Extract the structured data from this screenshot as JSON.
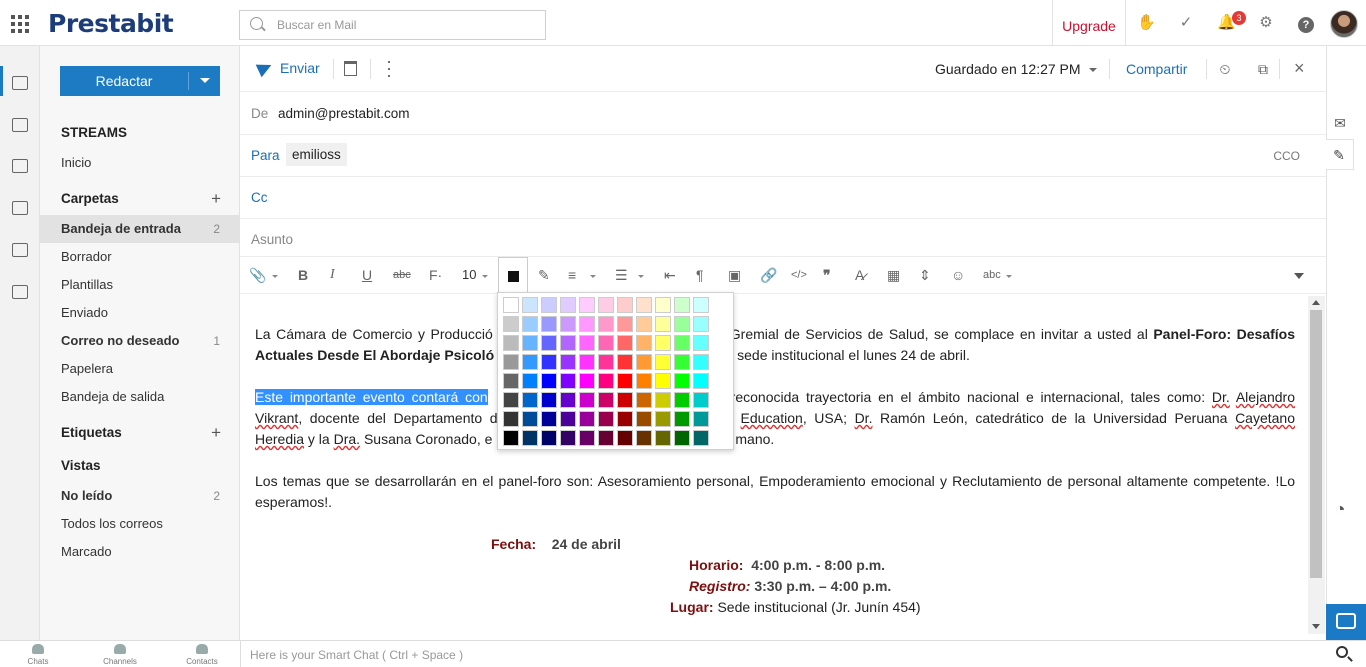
{
  "app": {
    "logo": "Prestabit"
  },
  "search": {
    "placeholder": "Buscar en Mail"
  },
  "topbar": {
    "upgrade": "Upgrade",
    "notification_count": "3",
    "help": "?"
  },
  "sidebar": {
    "compose": "Redactar",
    "streams_header": "STREAMS",
    "inicio": "Inicio",
    "folders_header": "Carpetas",
    "folders": [
      {
        "label": "Bandeja de entrada",
        "count": "2"
      },
      {
        "label": "Borrador",
        "count": ""
      },
      {
        "label": "Plantillas",
        "count": ""
      },
      {
        "label": "Enviado",
        "count": ""
      },
      {
        "label": "Correo no deseado",
        "count": "1"
      },
      {
        "label": "Papelera",
        "count": ""
      },
      {
        "label": "Bandeja de salida",
        "count": ""
      }
    ],
    "tags_header": "Etiquetas",
    "views_header": "Vistas",
    "views": [
      {
        "label": "No leído",
        "count": "2"
      },
      {
        "label": "Todos los correos",
        "count": ""
      },
      {
        "label": "Marcado",
        "count": ""
      }
    ]
  },
  "toolbar": {
    "send": "Enviar",
    "saved": "Guardado en 12:27 PM",
    "share": "Compartir"
  },
  "compose": {
    "from_label": "De",
    "from_value": "admin@prestabit.com",
    "to_label": "Para",
    "to_chip": "emilioss",
    "cco": "CCO",
    "cc_label": "Cc",
    "subject_placeholder": "Asunto"
  },
  "format": {
    "font_size": "10",
    "current_color": "#111111"
  },
  "palette": {
    "rows": [
      [
        "#ffffff",
        "#cce5ff",
        "#ccccff",
        "#e0ccff",
        "#ffccff",
        "#ffcce6",
        "#ffcccc",
        "#ffe0cc",
        "#ffffcc",
        "#ccffcc",
        "#ccffff"
      ],
      [
        "#cccccc",
        "#99ccff",
        "#9999ff",
        "#cc99ff",
        "#ff99ff",
        "#ff99cc",
        "#ff9999",
        "#ffcc99",
        "#ffff99",
        "#99ff99",
        "#99ffff"
      ],
      [
        "#bbbbbb",
        "#66b3ff",
        "#6666ff",
        "#b366ff",
        "#ff66ff",
        "#ff66b3",
        "#ff6666",
        "#ffb366",
        "#ffff66",
        "#66ff66",
        "#66ffff"
      ],
      [
        "#999999",
        "#3399ff",
        "#3333ff",
        "#9933ff",
        "#ff33ff",
        "#ff3399",
        "#ff3333",
        "#ff9933",
        "#ffff33",
        "#33ff33",
        "#33ffff"
      ],
      [
        "#666666",
        "#0080ff",
        "#0000ff",
        "#8000ff",
        "#ff00ff",
        "#ff0080",
        "#ff0000",
        "#ff8000",
        "#ffff00",
        "#00ff00",
        "#00ffff"
      ],
      [
        "#444444",
        "#0066cc",
        "#0000cc",
        "#6600cc",
        "#cc00cc",
        "#cc0066",
        "#cc0000",
        "#cc6600",
        "#cccc00",
        "#00cc00",
        "#00cccc"
      ],
      [
        "#333333",
        "#004c99",
        "#000099",
        "#4c0099",
        "#990099",
        "#99004c",
        "#990000",
        "#994c00",
        "#999900",
        "#009900",
        "#009999"
      ],
      [
        "#000000",
        "#003366",
        "#000066",
        "#330066",
        "#660066",
        "#660033",
        "#660000",
        "#663300",
        "#666600",
        "#006600",
        "#006666"
      ]
    ]
  },
  "email": {
    "p1_a": "La Cámara de Comercio y Producció",
    "p1_b": "Gremial de Servicios de Salud,  se complace en invitar a usted al ",
    "p1_bold": "Panel-Foro: Desafíos Actuales Desde El Abordaje Psicoló",
    "p1_c": "sede institucional el lunes 24 de abril.",
    "p2_sel": "Este importante evento contará con",
    "p2_a": "reconocida trayectoria en el ámbito nacional e internacional, tales como: ",
    "p2_dr": "Dr.",
    "p2_alejandro": "Alejandro",
    "p2_vikrant": "Vikrant",
    "p2_b": ", docente del Departamento d",
    "p2_education": "Education",
    "p2_c": ", USA; ",
    "p2_dr2": "Dr.",
    "p2_d": " Ramón León, catedrático de la Universidad Peruana ",
    "p2_cayetano": "Cayetano",
    "p2_heredia": "Heredia",
    "p2_e": " y la ",
    "p2_dra": "Dra.",
    "p2_f": " Susana Coronado, e",
    "p2_g": "mano.",
    "p3": "Los temas que se desarrollarán en el panel-foro son: Asesoramiento personal, Empoderamiento emocional y Reclutamiento de personal altamente competente. !Lo esperamos!.",
    "fecha_label": "Fecha:",
    "fecha_value": "24 de abril",
    "horario_label": "Horario:",
    "horario_value": "4:00 p.m. - 8:00 p.m.",
    "registro_label": "Registro:",
    "registro_value": "3:30 p.m. – 4:00 p.m.",
    "lugar_label": "Lugar:",
    "lugar_value": "Sede institucional (Jr. Junín 454)"
  },
  "bottom": {
    "chats": "Chats",
    "channels": "Channels",
    "contacts": "Contacts",
    "smart_chat": "Here is your Smart Chat ( Ctrl + Space )"
  }
}
